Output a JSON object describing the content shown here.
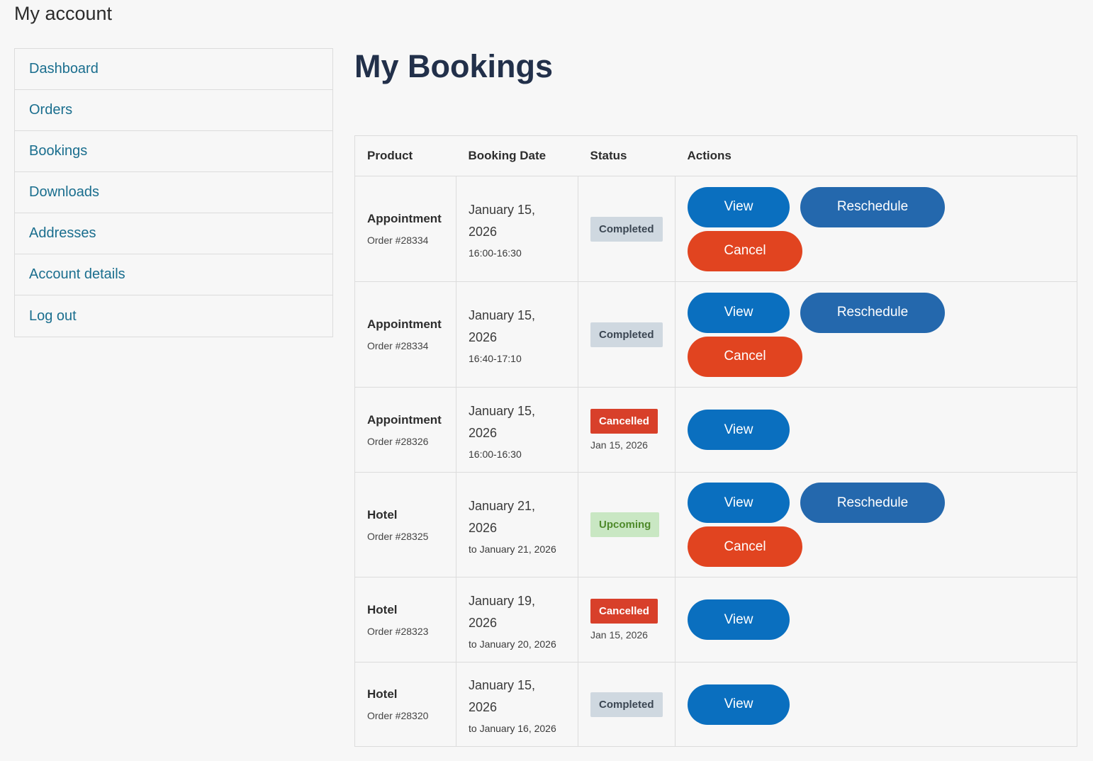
{
  "page": {
    "title": "My account"
  },
  "sidebar": {
    "items": [
      {
        "label": "Dashboard"
      },
      {
        "label": "Orders"
      },
      {
        "label": "Bookings"
      },
      {
        "label": "Downloads"
      },
      {
        "label": "Addresses"
      },
      {
        "label": "Account details"
      },
      {
        "label": "Log out"
      }
    ]
  },
  "main": {
    "heading": "My Bookings",
    "columns": [
      "Product",
      "Booking Date",
      "Status",
      "Actions"
    ],
    "rows": [
      {
        "product": "Appointment",
        "order": "Order #28334",
        "date": "January 15, 2026",
        "date_sub": "16:00-16:30",
        "status": "Completed",
        "status_sub": "",
        "actions": [
          "View",
          "Reschedule",
          "Cancel"
        ]
      },
      {
        "product": "Appointment",
        "order": "Order #28334",
        "date": "January 15, 2026",
        "date_sub": "16:40-17:10",
        "status": "Completed",
        "status_sub": "",
        "actions": [
          "View",
          "Reschedule",
          "Cancel"
        ]
      },
      {
        "product": "Appointment",
        "order": "Order #28326",
        "date": "January 15, 2026",
        "date_sub": "16:00-16:30",
        "status": "Cancelled",
        "status_sub": "Jan 15, 2026",
        "actions": [
          "View"
        ]
      },
      {
        "product": "Hotel",
        "order": "Order #28325",
        "date": "January 21, 2026",
        "date_sub": "to January 21, 2026",
        "status": "Upcoming",
        "status_sub": "",
        "actions": [
          "View",
          "Reschedule",
          "Cancel"
        ]
      },
      {
        "product": "Hotel",
        "order": "Order #28323",
        "date": "January 19, 2026",
        "date_sub": "to January 20, 2026",
        "status": "Cancelled",
        "status_sub": "Jan 15, 2026",
        "actions": [
          "View"
        ]
      },
      {
        "product": "Hotel",
        "order": "Order #28320",
        "date": "January 15, 2026",
        "date_sub": "to January 16, 2026",
        "status": "Completed",
        "status_sub": "",
        "actions": [
          "View"
        ]
      }
    ]
  },
  "colors": {
    "link": "#1a6e8e",
    "heading": "#22304a",
    "view_button": "#0a6fbf",
    "reschedule_button": "#2468ad",
    "cancel_button": "#e14420",
    "badge_completed": "#cfd8e0",
    "badge_cancelled": "#d8402a",
    "badge_upcoming": "#c9e7c3"
  }
}
